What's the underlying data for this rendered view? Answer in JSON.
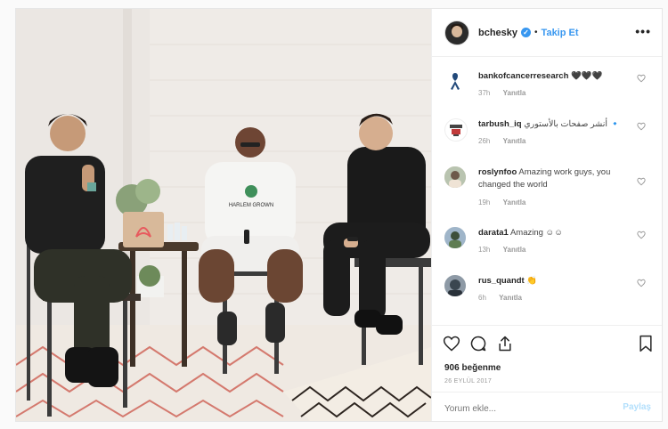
{
  "header": {
    "username": "bchesky",
    "separator": "•",
    "follow_label": "Takip Et",
    "more_label": "•••"
  },
  "photo": {
    "shirt_text": "HARLEM GROWN"
  },
  "comments": [
    {
      "user": "bankofcancerresearch",
      "text": "🖤🖤🖤",
      "time": "37h",
      "reply": "Yanıtla",
      "avatar": "ribbon-icon"
    },
    {
      "user": "tarbush_iq",
      "text": "أنشر صفحات بالأستوري 🔹",
      "time": "26h",
      "reply": "Yanıtla",
      "avatar": "logo-avatar"
    },
    {
      "user": "roslynfoo",
      "text": "Amazing work guys, you changed the world",
      "time": "19h",
      "reply": "Yanıtla",
      "avatar": "user-avatar"
    },
    {
      "user": "darata1",
      "text": "Amazing ☺☺",
      "time": "13h",
      "reply": "Yanıtla",
      "avatar": "user-avatar"
    },
    {
      "user": "rus_quandt",
      "text": "👏",
      "time": "6h",
      "reply": "Yanıtla",
      "avatar": "user-avatar"
    }
  ],
  "actions": {
    "likes": "906 beğenme",
    "date": "26 EYLÜL 2017",
    "comment_placeholder": "Yorum ekle...",
    "share_label": "Paylaş"
  },
  "colors": {
    "accent": "#3897f0",
    "text": "#262626",
    "muted": "#999999",
    "share_disabled": "#b2dffc"
  }
}
